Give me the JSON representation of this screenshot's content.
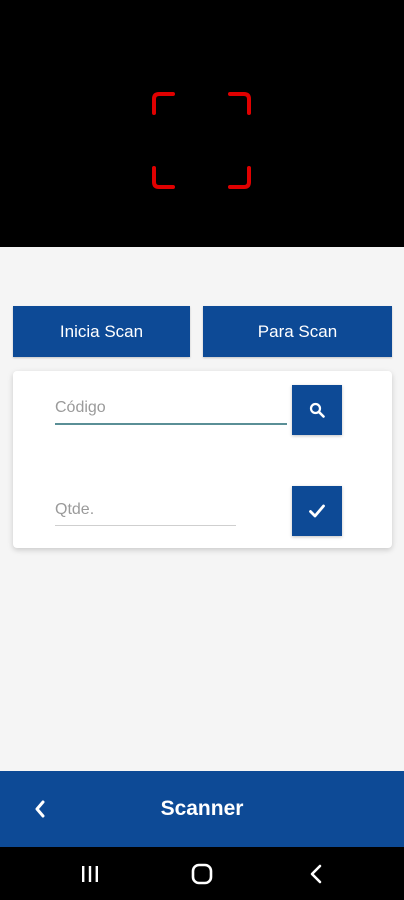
{
  "scanner": {
    "start_label": "Inicia Scan",
    "stop_label": "Para Scan"
  },
  "form": {
    "code_value": "",
    "code_placeholder": "Código",
    "qty_value": "",
    "qty_placeholder": "Qtde."
  },
  "appbar": {
    "title": "Scanner"
  },
  "icons": {
    "scan_frame": "scan-frame-icon",
    "search": "search-icon",
    "confirm": "check-icon",
    "back": "chevron-left-icon",
    "nav_recents": "recents-icon",
    "nav_home": "home-icon",
    "nav_back": "back-icon"
  },
  "colors": {
    "primary": "#0d4a96",
    "scan_frame": "#e00000",
    "active_underline": "#5a8f96",
    "background": "#f5f5f5"
  }
}
